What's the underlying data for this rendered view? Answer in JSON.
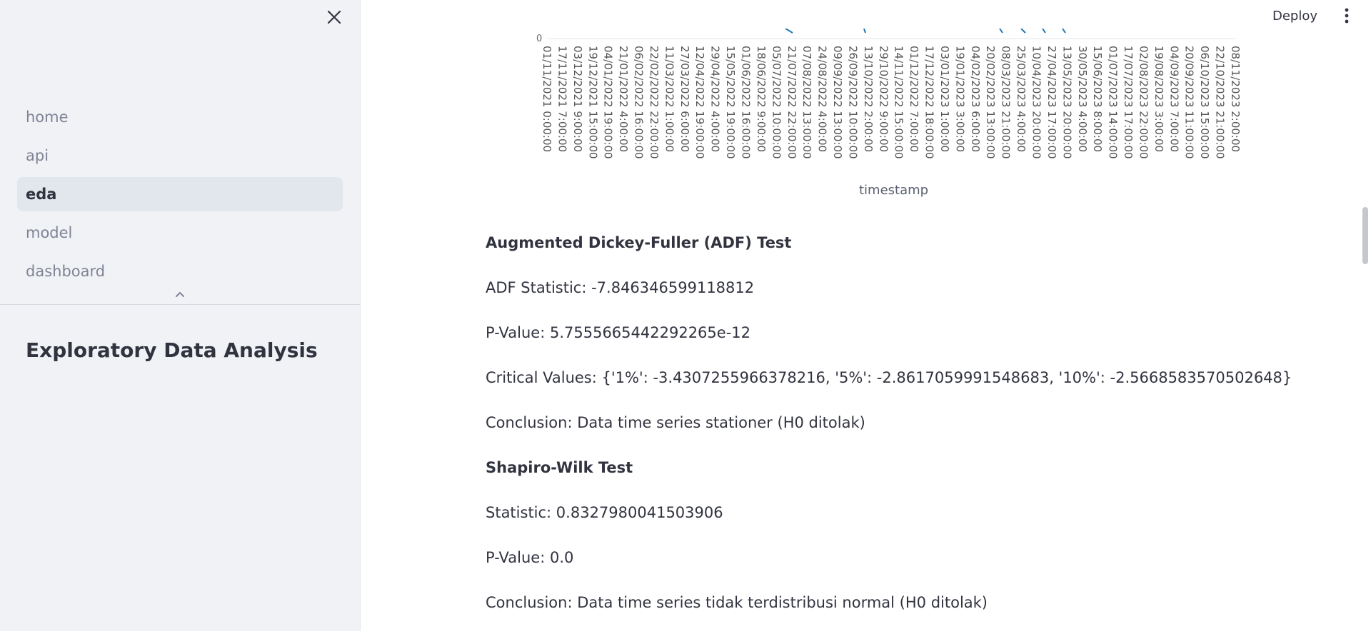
{
  "sidebar": {
    "nav": [
      {
        "label": "home",
        "active": false
      },
      {
        "label": "api",
        "active": false
      },
      {
        "label": "eda",
        "active": true
      },
      {
        "label": "model",
        "active": false
      },
      {
        "label": "dashboard",
        "active": false
      }
    ],
    "title": "Exploratory Data Analysis",
    "close_icon": "close-icon",
    "collapse_icon": "chevron-up-icon"
  },
  "header": {
    "deploy_label": "Deploy",
    "menu_icon": "kebab-menu-icon"
  },
  "chart_data": {
    "type": "line",
    "xlabel": "timestamp",
    "y_ticks_visible": [
      "0"
    ],
    "x_tick_labels": [
      "01/11/2021 0:00:00",
      "17/11/2021 7:00:00",
      "03/12/2021 9:00:00",
      "19/12/2021 15:00:00",
      "04/01/2022 19:00:00",
      "21/01/2022 4:00:00",
      "06/02/2022 16:00:00",
      "22/02/2022 22:00:00",
      "11/03/2022 1:00:00",
      "27/03/2022 6:00:00",
      "12/04/2022 19:00:00",
      "29/04/2022 4:00:00",
      "15/05/2022 19:00:00",
      "01/06/2022 16:00:00",
      "18/06/2022 9:00:00",
      "05/07/2022 10:00:00",
      "21/07/2022 22:00:00",
      "07/08/2022 13:00:00",
      "24/08/2022 4:00:00",
      "09/09/2022 13:00:00",
      "26/09/2022 10:00:00",
      "13/10/2022 2:00:00",
      "29/10/2022 9:00:00",
      "14/11/2022 15:00:00",
      "01/12/2022 7:00:00",
      "17/12/2022 18:00:00",
      "03/01/2023 1:00:00",
      "19/01/2023 3:00:00",
      "04/02/2023 6:00:00",
      "20/02/2023 13:00:00",
      "08/03/2023 21:00:00",
      "25/03/2023 4:00:00",
      "10/04/2023 20:00:00",
      "27/04/2023 17:00:00",
      "13/05/2023 20:00:00",
      "30/05/2023 4:00:00",
      "15/06/2023 8:00:00",
      "01/07/2023 14:00:00",
      "17/07/2023 17:00:00",
      "02/08/2023 22:00:00",
      "19/08/2023 3:00:00",
      "04/09/2023 7:00:00",
      "20/09/2023 11:00:00",
      "06/10/2023 15:00:00",
      "22/10/2023 21:00:00",
      "08/11/2023 2:00:00"
    ],
    "colors": {
      "series": "#1f77b4",
      "tick_text": "#555555"
    }
  },
  "results": [
    {
      "text": "Augmented Dickey-Fuller (ADF) Test",
      "bold": true
    },
    {
      "text": "ADF Statistic: -7.846346599118812",
      "bold": false
    },
    {
      "text": "P-Value: 5.7555665442292265e-12",
      "bold": false
    },
    {
      "text": "Critical Values: {'1%': -3.4307255966378216, '5%': -2.8617059991548683, '10%': -2.5668583570502648}",
      "bold": false
    },
    {
      "text": "Conclusion: Data time series stationer (H0 ditolak)",
      "bold": false
    },
    {
      "text": "Shapiro-Wilk Test",
      "bold": true
    },
    {
      "text": "Statistic: 0.8327980041503906",
      "bold": false
    },
    {
      "text": "P-Value: 0.0",
      "bold": false
    },
    {
      "text": "Conclusion: Data time series tidak terdistribusi normal (H0 ditolak)",
      "bold": false
    }
  ]
}
